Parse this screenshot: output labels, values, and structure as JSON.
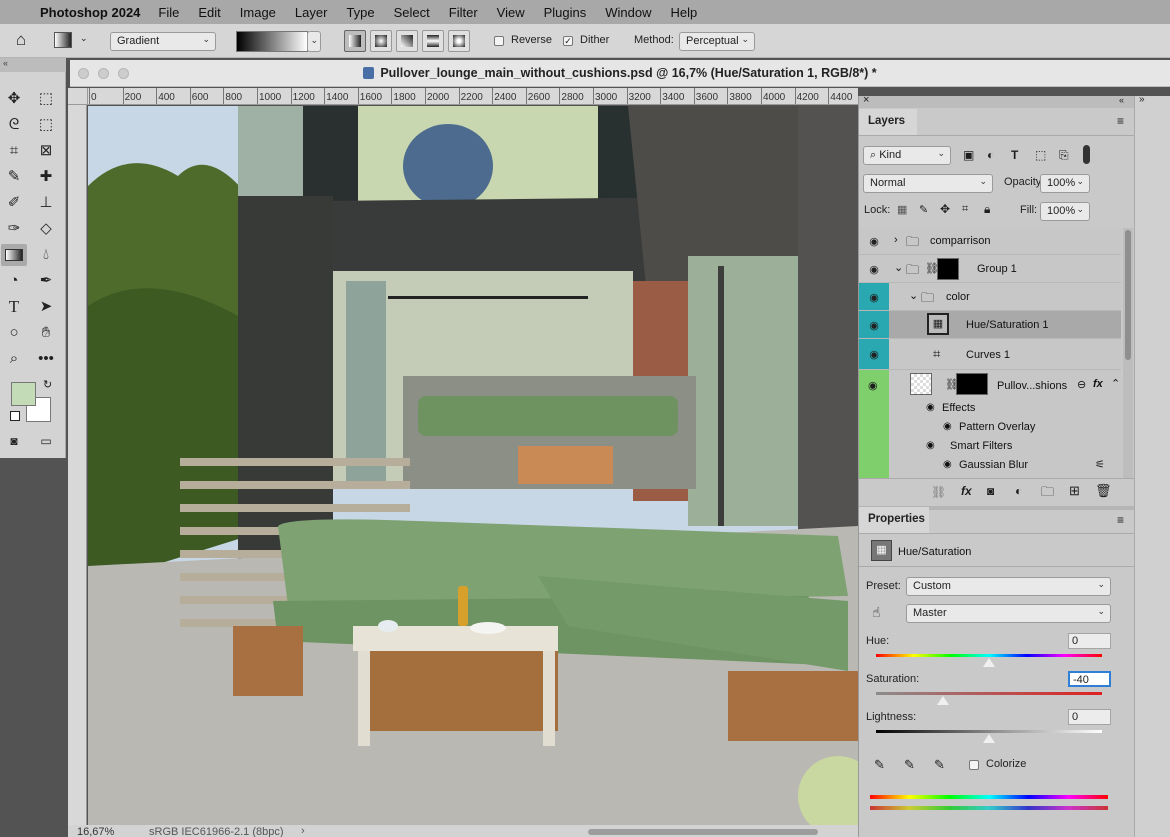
{
  "menubar": {
    "app_name": "Photoshop 2024",
    "items": [
      "File",
      "Edit",
      "Image",
      "Layer",
      "Type",
      "Select",
      "Filter",
      "View",
      "Plugins",
      "Window",
      "Help"
    ]
  },
  "options_bar": {
    "tool_preset": "Gradient",
    "reverse_label": "Reverse",
    "reverse_checked": false,
    "dither_label": "Dither",
    "dither_checked": true,
    "method_label": "Method:",
    "method_value": "Perceptual"
  },
  "document": {
    "title": "Pullover_lounge_main_without_cushions.psd @ 16,7% (Hue/Saturation 1, RGB/8*) *",
    "ruler_ticks": [
      "0",
      "200",
      "400",
      "600",
      "800",
      "1000",
      "1200",
      "1400",
      "1600",
      "1800",
      "2000",
      "2200",
      "2400",
      "2600",
      "2800",
      "3000",
      "3200",
      "3400",
      "3600",
      "3800",
      "4000",
      "4200",
      "4400"
    ],
    "zoom": "16,67%",
    "color_profile": "sRGB IEC61966-2.1 (8bpc)"
  },
  "colors": {
    "foreground": "#c4dbb8",
    "background": "#ffffff",
    "eye_green": "#7fcf6d",
    "eye_teal": "#29a8b1"
  },
  "layers": {
    "tab": "Layers",
    "kind_label": "Kind",
    "blend_mode": "Normal",
    "opacity_label": "Opacity:",
    "opacity": "100%",
    "lock_label": "Lock:",
    "fill_label": "Fill:",
    "fill": "100%",
    "rows": {
      "comparison": "comparrison",
      "group1": "Group 1",
      "color": "color",
      "hue_sat": "Hue/Saturation 1",
      "curves": "Curves 1",
      "pullover": "Pullov...shions",
      "effects": "Effects",
      "pattern_overlay": "Pattern Overlay",
      "smart_filters": "Smart Filters",
      "gaussian_blur": "Gaussian Blur"
    }
  },
  "properties": {
    "tab": "Properties",
    "adjustment_title": "Hue/Saturation",
    "preset_label": "Preset:",
    "preset_value": "Custom",
    "channel_value": "Master",
    "hue_label": "Hue:",
    "hue_value": "0",
    "saturation_label": "Saturation:",
    "saturation_value": "-40",
    "lightness_label": "Lightness:",
    "lightness_value": "0",
    "colorize_label": "Colorize"
  }
}
